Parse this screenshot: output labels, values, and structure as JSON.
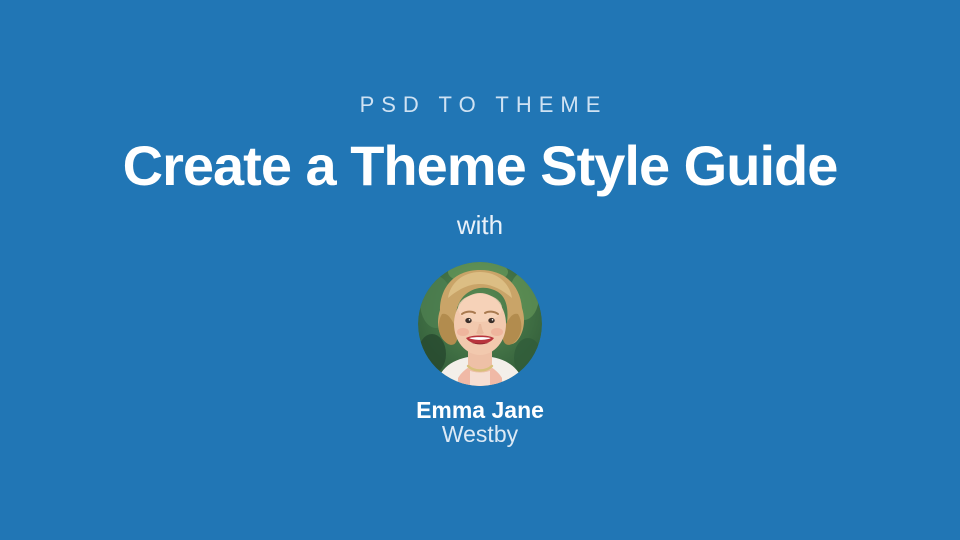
{
  "slide": {
    "eyebrow": "PSD TO THEME",
    "title": "Create a Theme Style Guide",
    "with_label": "with",
    "author": {
      "first_line": "Emma Jane",
      "second_line": "Westby"
    },
    "avatar_description": "circular photo of instructor with short wavy blonde hair smiling, green foliage background"
  },
  "colors": {
    "background": "#2176b5",
    "eyebrow_text": "#cfe2f3",
    "title_text": "#ffffff",
    "with_text": "#e9f1f9",
    "author_name_text": "#ffffff",
    "author_surname_text": "#dce9f5"
  }
}
